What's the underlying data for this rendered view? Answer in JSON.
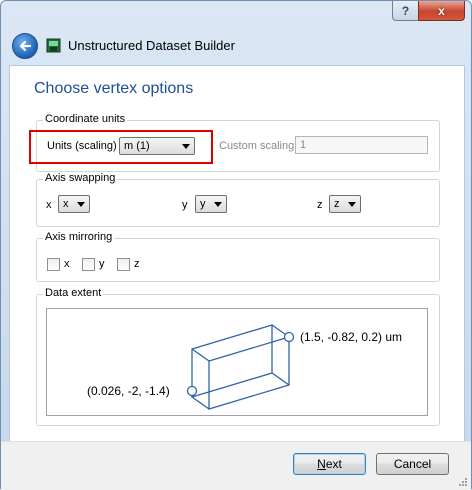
{
  "window": {
    "title": "Unstructured Dataset Builder",
    "help_label": "?",
    "close_label": "x"
  },
  "page": {
    "title": "Choose vertex options"
  },
  "coordinate_units": {
    "group_label": "Coordinate units",
    "units_label": "Units (scaling)",
    "units_value": "m (1)",
    "custom_scaling_label": "Custom scaling",
    "custom_scaling_value": "1"
  },
  "axis_swapping": {
    "group_label": "Axis swapping",
    "x_label": "x",
    "x_value": "x",
    "y_label": "y",
    "y_value": "y",
    "z_label": "z",
    "z_value": "z"
  },
  "axis_mirroring": {
    "group_label": "Axis mirroring",
    "x_label": "x",
    "y_label": "y",
    "z_label": "z",
    "x_checked": false,
    "y_checked": false,
    "z_checked": false
  },
  "data_extent": {
    "group_label": "Data extent",
    "max_corner": "(1.5, -0.82, 0.2) um",
    "min_corner": "(0.026, -2, -1.4)"
  },
  "footer": {
    "next_mnemonic": "N",
    "next_rest": "ext",
    "cancel_label": "Cancel"
  },
  "colors": {
    "title_blue": "#1f4e9a",
    "highlight_red": "#e00000",
    "extent_line": "#2f63a8"
  }
}
